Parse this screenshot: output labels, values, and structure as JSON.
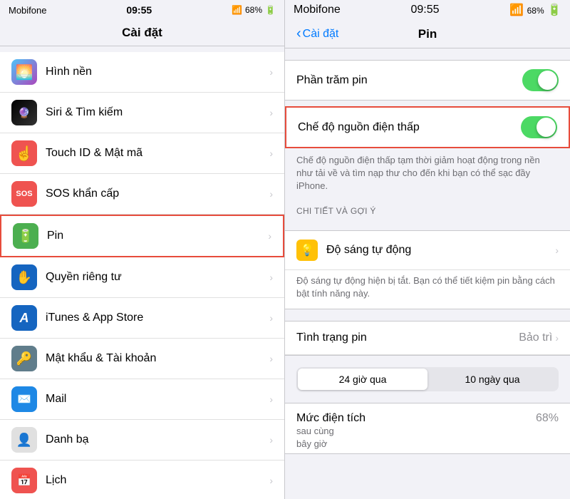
{
  "left": {
    "statusBar": {
      "carrier": "Mobifone",
      "time": "09:55",
      "battery": "68%"
    },
    "navTitle": "Cài đặt",
    "items": [
      {
        "id": "hinh-nen",
        "label": "Hình nền",
        "icon": "🌅",
        "iconClass": "icon-wallpaper"
      },
      {
        "id": "siri",
        "label": "Siri & Tìm kiếm",
        "icon": "🔮",
        "iconClass": "icon-siri"
      },
      {
        "id": "touchid",
        "label": "Touch ID & Mật mã",
        "icon": "☝️",
        "iconClass": "icon-touchid"
      },
      {
        "id": "sos",
        "label": "SOS khẩn cấp",
        "icon": "SOS",
        "iconClass": "icon-sos",
        "isSOS": true
      },
      {
        "id": "pin",
        "label": "Pin",
        "icon": "🔋",
        "iconClass": "icon-pin",
        "highlighted": true
      },
      {
        "id": "privacy",
        "label": "Quyền riêng tư",
        "icon": "✋",
        "iconClass": "icon-privacy"
      },
      {
        "id": "itunes",
        "label": "iTunes & App Store",
        "icon": "A",
        "iconClass": "icon-itunes"
      },
      {
        "id": "matkhau",
        "label": "Mật khẩu & Tài khoản",
        "icon": "🔑",
        "iconClass": "icon-matkhau"
      },
      {
        "id": "mail",
        "label": "Mail",
        "icon": "✉️",
        "iconClass": "icon-mail"
      },
      {
        "id": "danhba",
        "label": "Danh bạ",
        "icon": "👤",
        "iconClass": "icon-danhba"
      },
      {
        "id": "lich",
        "label": "Lịch",
        "icon": "📅",
        "iconClass": "icon-lich"
      }
    ]
  },
  "right": {
    "statusBar": {
      "carrier": "Mobifone",
      "time": "09:55",
      "battery": "68%"
    },
    "backLabel": "Cài đặt",
    "navTitle": "Pin",
    "sections": {
      "phantramPin": {
        "label": "Phần trăm pin",
        "toggleOn": true
      },
      "cheDo": {
        "label": "Chế độ nguồn điện thấp",
        "toggleOn": true,
        "highlighted": true,
        "description": "Chế độ nguồn điện thấp tạm thời giảm hoạt động trong nền như tải về và tìm nạp thư cho đến khi bạn có thể sạc đầy iPhone."
      },
      "chiTietHeader": "CHI TIẾT VÀ GỢI Ý",
      "doSang": {
        "label": "Độ sáng tự động",
        "description": "Độ sáng tự động hiện bị tắt. Bạn có thể tiết kiệm pin bằng cách bật tính năng này."
      },
      "tinhTrang": {
        "label": "Tình trạng pin",
        "value": "Bảo trì"
      },
      "tabs": {
        "tab1": "24 giờ qua",
        "tab2": "10 ngày qua",
        "activeTab": 0
      },
      "mucDienTich": {
        "label": "Mức điện tích",
        "subLabel": "sau cùng",
        "subLabel2": "bây giờ",
        "value": "68%"
      }
    }
  }
}
